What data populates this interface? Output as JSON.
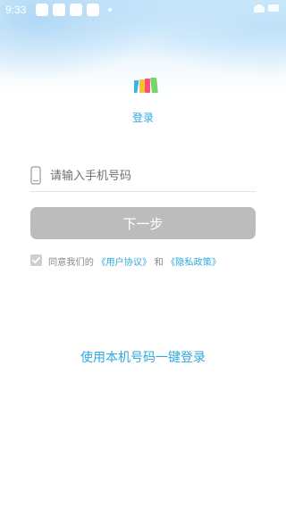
{
  "status_bar": {
    "time": "9:33"
  },
  "header": {
    "title": "登录"
  },
  "login": {
    "phone_placeholder": "请输入手机号码",
    "next_label": "下一步",
    "agree_prefix": "同意我们的",
    "user_agreement": "《用户协议》",
    "agree_and": "和",
    "privacy_policy": "《隐私政策》",
    "one_key_login": "使用本机号码一键登录"
  },
  "colors": {
    "accent": "#2ea9df",
    "button_disabled": "#bcbcbc"
  },
  "icons": {
    "logo": "app-logo-icon",
    "phone": "phone-icon",
    "checkbox": "checkbox-checked-icon"
  }
}
